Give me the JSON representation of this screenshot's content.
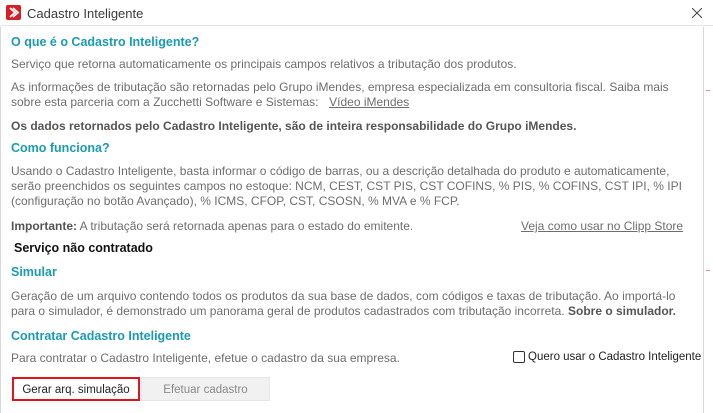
{
  "window": {
    "title": "Cadastro Inteligente",
    "app_icon": "clipp-logo-icon",
    "close_icon": "close-icon"
  },
  "section_what": {
    "heading": "O que é o Cadastro Inteligente?",
    "p1": "Serviço que retorna automaticamente os principais campos relativos a tributação dos produtos.",
    "p2_line1": "As informações de tributação são retornadas pelo Grupo iMendes, empresa especializada em consultoria fiscal. Saiba mais",
    "p2_line2": "sobre esta parceria com a Zucchetti Software e Sistemas:",
    "p2_link": "Vídeo iMendes",
    "disclaimer": "Os dados retornados pelo Cadastro Inteligente, são de inteira responsabilidade do Grupo iMendes."
  },
  "section_how": {
    "heading": "Como funciona?",
    "line1": "Usando o Cadastro Inteligente, basta informar o código de barras, ou a descrição detalhada do produto e automaticamente,",
    "line2": "serão preenchidos os seguintes campos no estoque: NCM, CEST, CST PIS, CST COFINS, % PIS, % COFINS, CST IPI, % IPI",
    "line3": "(configuração no botão Avançado), % ICMS, CFOP, CST, CSOSN, % MVA e % FCP.",
    "important_label": "Importante:",
    "important_text": "A tributação será retornada apenas para o estado do emitente.",
    "clipp_store_link": "Veja como usar no Clipp Store"
  },
  "status": {
    "service_status": "Serviço não contratado"
  },
  "section_simulate": {
    "heading": "Simular",
    "line1": "Geração de um arquivo contendo todos os produtos da sua base de dados, com códigos e taxas de tributação. Ao importá-lo",
    "line2": "para o simulador, é demonstrado um panorama geral de produtos cadastrados com tributação incorreta.",
    "line2_link": "Sobre o simulador."
  },
  "section_contract": {
    "heading": "Contratar Cadastro Inteligente",
    "text": "Para contratar o Cadastro Inteligente, efetue o cadastro da sua empresa.",
    "checkbox_label": "Quero usar o Cadastro Inteligente",
    "checkbox_checked": false
  },
  "buttons": {
    "generate_simulation": "Gerar arq. simulação",
    "register": "Efetuar cadastro"
  },
  "colors": {
    "heading": "#1a9bb5",
    "highlight_border": "#e0141c",
    "brand": "#d71f26"
  }
}
